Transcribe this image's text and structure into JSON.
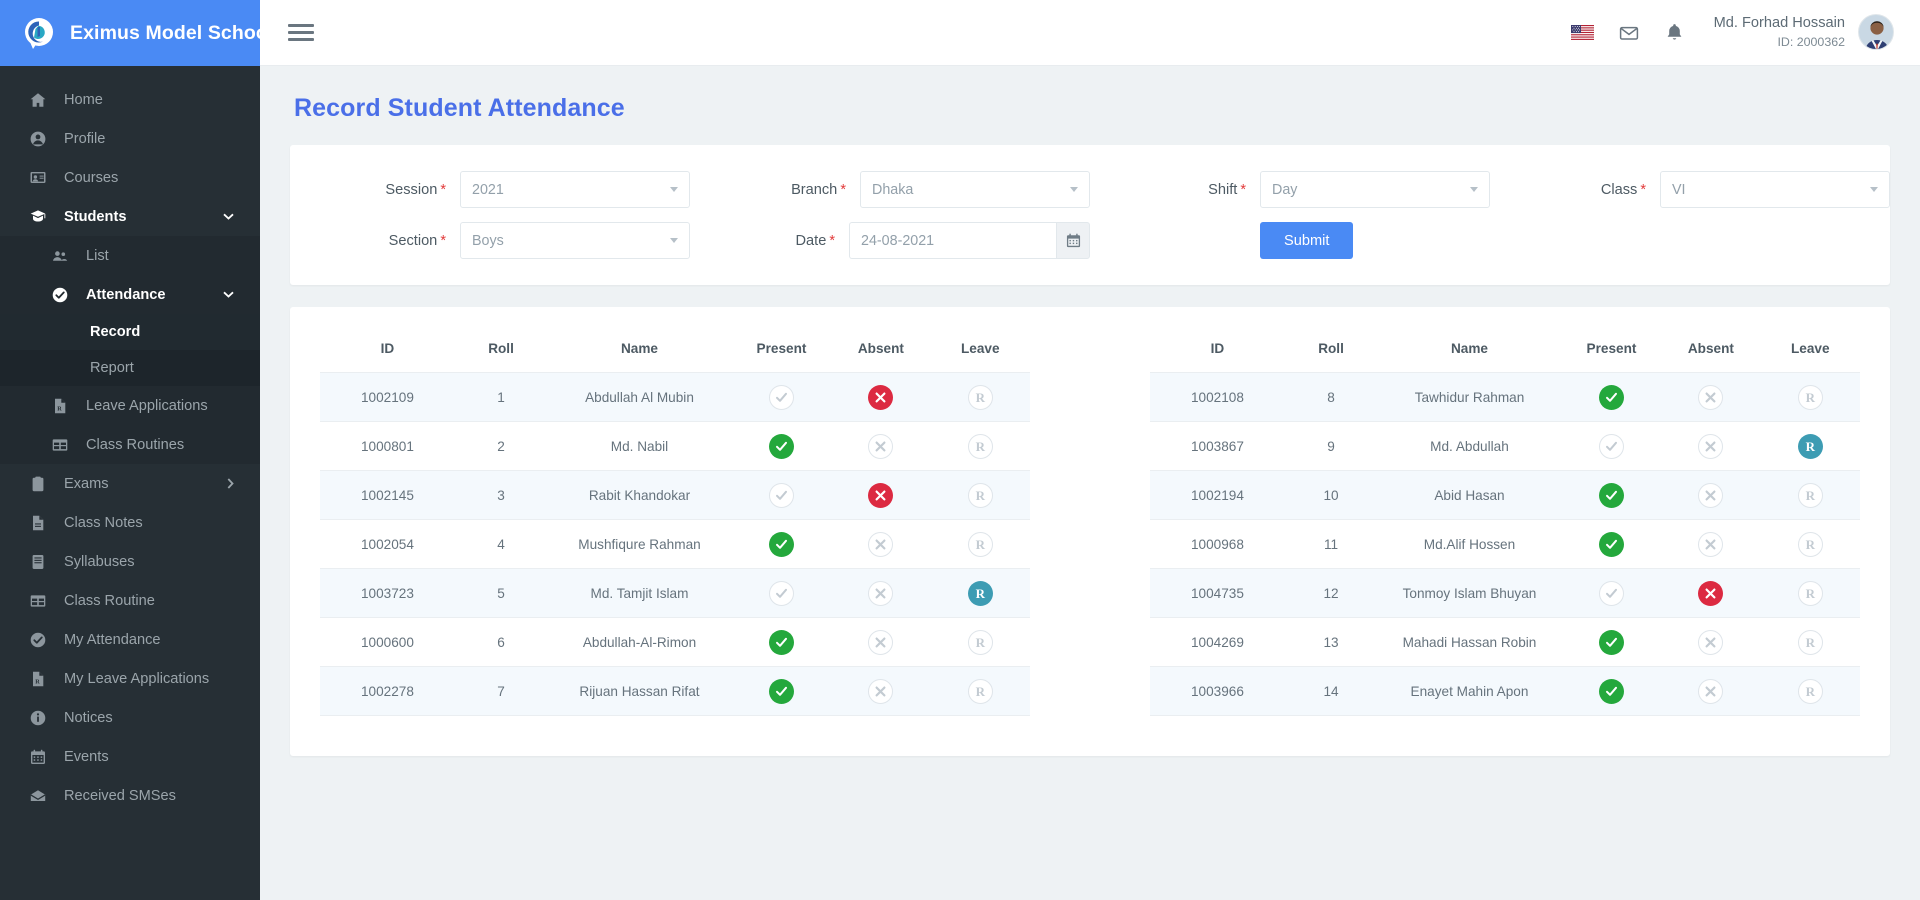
{
  "brand": {
    "name": "Eximus Model School",
    "logo_icon": "spiral-logo-icon"
  },
  "sidebar": {
    "items": [
      {
        "label": "Home",
        "icon": "home-icon",
        "name": "home"
      },
      {
        "label": "Profile",
        "icon": "user-circle-icon",
        "name": "profile"
      },
      {
        "label": "Courses",
        "icon": "courses-icon",
        "name": "courses"
      },
      {
        "label": "Students",
        "icon": "graduation-cap-icon",
        "name": "students",
        "expanded": true,
        "chevron": "chevron-down-icon"
      },
      {
        "label": "Exams",
        "icon": "clipboard-icon",
        "name": "exams",
        "chevron": "chevron-right-icon"
      },
      {
        "label": "Class Notes",
        "icon": "note-icon",
        "name": "class-notes"
      },
      {
        "label": "Syllabuses",
        "icon": "book-icon",
        "name": "syllabuses"
      },
      {
        "label": "Class Routine",
        "icon": "table-icon",
        "name": "class-routine"
      },
      {
        "label": "My Attendance",
        "icon": "check-circle-icon",
        "name": "my-attendance"
      },
      {
        "label": "My Leave Applications",
        "icon": "file-rx-icon",
        "name": "my-leave-applications"
      },
      {
        "label": "Notices",
        "icon": "info-circle-icon",
        "name": "notices"
      },
      {
        "label": "Events",
        "icon": "calendar-icon",
        "name": "events"
      },
      {
        "label": "Received SMSes",
        "icon": "envelope-open-icon",
        "name": "received-smses"
      }
    ],
    "students_submenu": [
      {
        "label": "List",
        "icon": "users-icon",
        "name": "list"
      },
      {
        "label": "Attendance",
        "icon": "check-circle-icon",
        "name": "attendance",
        "active": true,
        "chevron": "chevron-down-icon"
      },
      {
        "label": "Leave Applications",
        "icon": "file-rx-icon",
        "name": "leave-applications"
      },
      {
        "label": "Class Routines",
        "icon": "table-icon",
        "name": "class-routines"
      }
    ],
    "attendance_submenu": [
      {
        "label": "Record",
        "name": "record",
        "current": true
      },
      {
        "label": "Report",
        "name": "report",
        "current": false
      }
    ]
  },
  "topbar": {
    "menu_icon": "hamburger-icon",
    "language_icon": "us-flag-icon",
    "mail_icon": "envelope-icon",
    "notification_icon": "bell-icon",
    "user_name": "Md. Forhad Hossain",
    "user_id": "ID: 2000362",
    "avatar_icon": "user-avatar"
  },
  "page": {
    "title": "Record Student Attendance"
  },
  "filters": {
    "session": {
      "label": "Session",
      "required": "*",
      "value": "2021"
    },
    "branch": {
      "label": "Branch",
      "required": "*",
      "value": "Dhaka"
    },
    "shift": {
      "label": "Shift",
      "required": "*",
      "value": "Day"
    },
    "class": {
      "label": "Class",
      "required": "*",
      "value": "VI"
    },
    "section": {
      "label": "Section",
      "required": "*",
      "value": "Boys"
    },
    "date": {
      "label": "Date",
      "required": "*",
      "value": "24-08-2021",
      "icon": "calendar-icon"
    },
    "submit_label": "Submit"
  },
  "table": {
    "headers": [
      "ID",
      "Roll",
      "Name",
      "Present",
      "Absent",
      "Leave"
    ],
    "left_rows": [
      {
        "id": "1002109",
        "roll": "1",
        "name": "Abdullah Al Mubin",
        "status": "absent"
      },
      {
        "id": "1000801",
        "roll": "2",
        "name": "Md. Nabil",
        "status": "present"
      },
      {
        "id": "1002145",
        "roll": "3",
        "name": "Rabit Khandokar",
        "status": "absent"
      },
      {
        "id": "1002054",
        "roll": "4",
        "name": "Mushfiqure Rahman",
        "status": "present"
      },
      {
        "id": "1003723",
        "roll": "5",
        "name": "Md. Tamjit Islam",
        "status": "leave"
      },
      {
        "id": "1000600",
        "roll": "6",
        "name": "Abdullah-Al-Rimon",
        "status": "present"
      },
      {
        "id": "1002278",
        "roll": "7",
        "name": "Rijuan Hassan Rifat",
        "status": "present"
      }
    ],
    "right_rows": [
      {
        "id": "1002108",
        "roll": "8",
        "name": "Tawhidur Rahman",
        "status": "present"
      },
      {
        "id": "1003867",
        "roll": "9",
        "name": "Md. Abdullah",
        "status": "leave"
      },
      {
        "id": "1002194",
        "roll": "10",
        "name": "Abid Hasan",
        "status": "present"
      },
      {
        "id": "1000968",
        "roll": "11",
        "name": "Md.Alif Hossen",
        "status": "present"
      },
      {
        "id": "1004735",
        "roll": "12",
        "name": "Tonmoy Islam Bhuyan",
        "status": "absent"
      },
      {
        "id": "1004269",
        "roll": "13",
        "name": "Mahadi Hassan Robin",
        "status": "present"
      },
      {
        "id": "1003966",
        "roll": "14",
        "name": "Enayet Mahin Apon",
        "status": "present"
      }
    ]
  },
  "colors": {
    "brand_blue": "#4a8af4",
    "sidebar_bg": "#262f35",
    "page_bg": "#eef2f4",
    "title_blue": "#4a6fe8",
    "present_green": "#24a83c",
    "absent_red": "#dc2a41",
    "leave_teal": "#3d9cb3",
    "row_alt": "#f4f9fd"
  }
}
